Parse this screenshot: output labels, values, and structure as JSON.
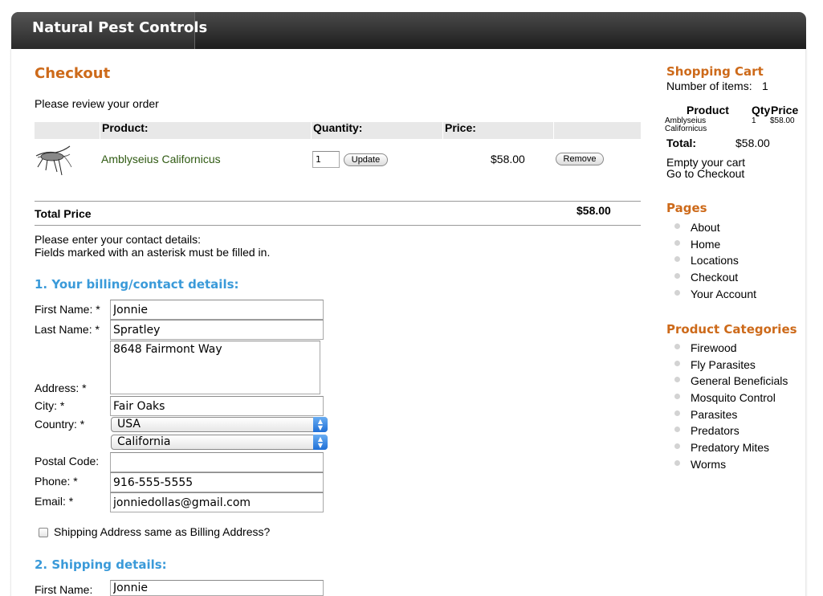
{
  "site": {
    "title": "Natural Pest Controls"
  },
  "checkout": {
    "title": "Checkout",
    "review_text": "Please review your order",
    "columns": {
      "product": "Product:",
      "quantity": "Quantity:",
      "price": "Price:"
    },
    "item": {
      "name": "Amblyseius Californicus",
      "quantity": "1",
      "price": "$58.00",
      "update_label": "Update",
      "remove_label": "Remove"
    },
    "total_label": "Total Price",
    "total_value": "$58.00",
    "contact_intro_1": "Please enter your contact details:",
    "contact_intro_2": "Fields marked with an asterisk must be filled in."
  },
  "billing": {
    "heading": "1. Your billing/contact details:",
    "first_name_label": "First Name: *",
    "first_name": "Jonnie",
    "last_name_label": "Last Name: *",
    "last_name": "Spratley",
    "address_label": "Address: *",
    "address": "8648 Fairmont Way",
    "city_label": "City: *",
    "city": "Fair Oaks",
    "country_label": "Country: *",
    "country": "USA",
    "state": "California",
    "postal_label": "Postal Code:",
    "postal": "",
    "phone_label": "Phone: *",
    "phone": "916-555-5555",
    "email_label": "Email: *",
    "email": "jonniedollas@gmail.com",
    "same_address_label": "Shipping Address same as Billing Address?"
  },
  "shipping": {
    "heading": "2. Shipping details:",
    "first_name_label": "First Name:",
    "first_name": "Jonnie"
  },
  "cart": {
    "title": "Shopping Cart",
    "items_text": "Number of items:",
    "items_count": "1",
    "col_product": "Product",
    "col_qty": "Qty",
    "col_price": "Price",
    "item_name_1": "Amblyseius",
    "item_name_2": "Californicus",
    "item_qty": "1",
    "item_price": "$58.00",
    "total_label": "Total:",
    "total_value": "$58.00",
    "empty_link": "Empty your cart",
    "checkout_link": "Go to Checkout"
  },
  "pages": {
    "title": "Pages",
    "items": [
      "About",
      "Home",
      "Locations",
      "Checkout",
      "Your Account"
    ]
  },
  "categories": {
    "title": "Product Categories",
    "items": [
      "Firewood",
      "Fly Parasites",
      "General Beneficials",
      "Mosquito Control",
      "Parasites",
      "Predators",
      "Predatory Mites",
      "Worms"
    ]
  },
  "colors": {
    "accent_orange": "#cd6a1a",
    "heading_blue": "#3a9ad9",
    "product_green": "#2f5a12"
  }
}
